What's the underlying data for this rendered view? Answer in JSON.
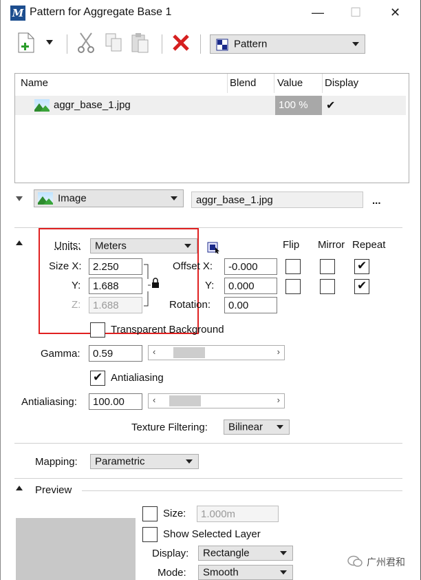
{
  "window": {
    "title": "Pattern for Aggregate Base 1",
    "logo_letter": "M",
    "minimize": "—",
    "maximize": "☐",
    "close": "✕"
  },
  "toolbar": {
    "mode_value": "Pattern"
  },
  "table": {
    "headers": [
      "Name",
      "Blend",
      "Value",
      "Display"
    ],
    "rows": [
      {
        "name": "aggr_base_1.jpg",
        "blend": "",
        "value": "100 %",
        "display": "✔"
      }
    ]
  },
  "image_row": {
    "type_value": "Image",
    "file_value": "aggr_base_1.jpg",
    "browse": "..."
  },
  "units": {
    "label": "Units:",
    "value": "Meters"
  },
  "columns": {
    "flip": "Flip",
    "mirror": "Mirror",
    "repeat": "Repeat"
  },
  "size": {
    "x_label": "Size X:",
    "x_value": "2.250",
    "y_label": "Y:",
    "y_value": "1.688",
    "z_label": "Z:",
    "z_value": "1.688"
  },
  "offset": {
    "x_label": "Offset X:",
    "x_value": "-0.000",
    "y_label": "Y:",
    "y_value": "0.000"
  },
  "rotation": {
    "label": "Rotation:",
    "value": "0.00"
  },
  "checks": {
    "flip_x": false,
    "mirror_x": false,
    "repeat_x": true,
    "flip_y": false,
    "mirror_y": false,
    "repeat_y": true,
    "mark": "✔"
  },
  "transparent_bg": {
    "label": "Transparent Background",
    "checked": false
  },
  "gamma": {
    "label": "Gamma:",
    "value": "0.59"
  },
  "antialiasing_check": {
    "label": "Antialiasing",
    "checked": true
  },
  "antialiasing": {
    "label": "Antialiasing:",
    "value": "100.00"
  },
  "texture_filtering": {
    "label": "Texture Filtering:",
    "value": "Bilinear"
  },
  "mapping": {
    "label": "Mapping:",
    "value": "Parametric"
  },
  "preview": {
    "title": "Preview",
    "size_label": "Size:",
    "size_value": "1.000m",
    "show_selected_layer": "Show Selected Layer",
    "display_label": "Display:",
    "display_value": "Rectangle",
    "mode_label": "Mode:",
    "mode_value": "Smooth"
  },
  "slider_arrows": {
    "left": "‹",
    "right": "›"
  },
  "watermark": {
    "text": "广州君和"
  },
  "colors": {
    "highlight": "#e02020",
    "value_cell": "#a8a8a8",
    "delete_x": "#d62020"
  }
}
